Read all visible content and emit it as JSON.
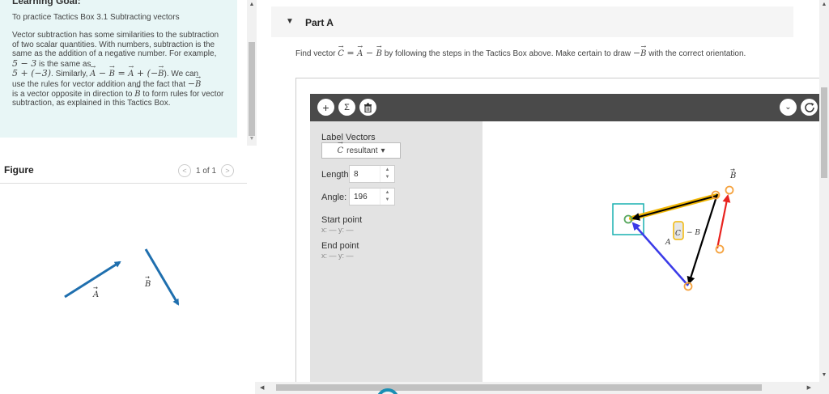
{
  "goal": {
    "heading": "Learning Goal:",
    "intro": "To practice Tactics Box 3.1 Subtracting vectors",
    "para1": "Vector subtraction has some similarities to the subtraction of two scalar quantities. With numbers, subtraction is the same as the addition of a negative number. For example, ",
    "ex1": "5 − 3",
    "para2": " is the same as",
    "ex2": "5 + (−3)",
    "para3": ". Similarly, ",
    "eq_a": "A",
    "eq_m1": " − ",
    "eq_b": "B",
    "eq_e": " = ",
    "eq_a2": "A",
    "eq_p": " + (−",
    "eq_b2": "B",
    "eq_c": "). We can",
    "para4": "use the rules for vector addition and the fact that ",
    "neg": "−",
    "negb": "B",
    "para5": "is a vector opposite in direction to ",
    "ofb": "B",
    "para6": " to form rules for vector subtraction, as explained in this Tactics Box."
  },
  "figure": {
    "label": "Figure",
    "pager": "1 of 1",
    "prev": "<",
    "next": ">",
    "vec_a": "A",
    "vec_b": "B"
  },
  "part": {
    "caret": "▼",
    "title": "Part A",
    "prompt_1": "Find vector ",
    "c": "C",
    "eqs": " = ",
    "a": "A",
    "minus": " − ",
    "b": "B",
    "prompt_2": " by following the steps in the Tactics Box above. Make certain to draw ",
    "neg_b": "−",
    "b2": "B",
    "prompt_3": " with the correct orientation."
  },
  "toolbar": {
    "add": "+",
    "sum": "Σ",
    "trash": "🗑",
    "collapse": "⌄",
    "reset": "↻"
  },
  "panel": {
    "label_vectors": "Label Vectors",
    "resultant_vec": "C",
    "resultant_text": "resultant",
    "dd_arrow": "▾",
    "length_label": "Length:",
    "length_value": "8",
    "angle_label": "Angle:",
    "angle_value": "196",
    "start_label": "Start point",
    "start_coords": "x: — y: —",
    "end_label": "End point",
    "end_coords": "x: — y: —"
  },
  "canvas": {
    "label_b": "B",
    "label_c": "C",
    "label_a": "A",
    "label_minus_b": "− B",
    "colors": {
      "yellow": "#f2b705",
      "black": "#000000",
      "red": "#e8231f",
      "blue": "#3b3be8",
      "teal": "#18b0b0",
      "orange": "#f5a340"
    }
  },
  "colors": {
    "goal_bg": "#e8f6f6",
    "figure_arrow": "#1f6fae",
    "toolbar_bg": "#4a4a4a",
    "panel_bg": "#e3e3e3"
  }
}
